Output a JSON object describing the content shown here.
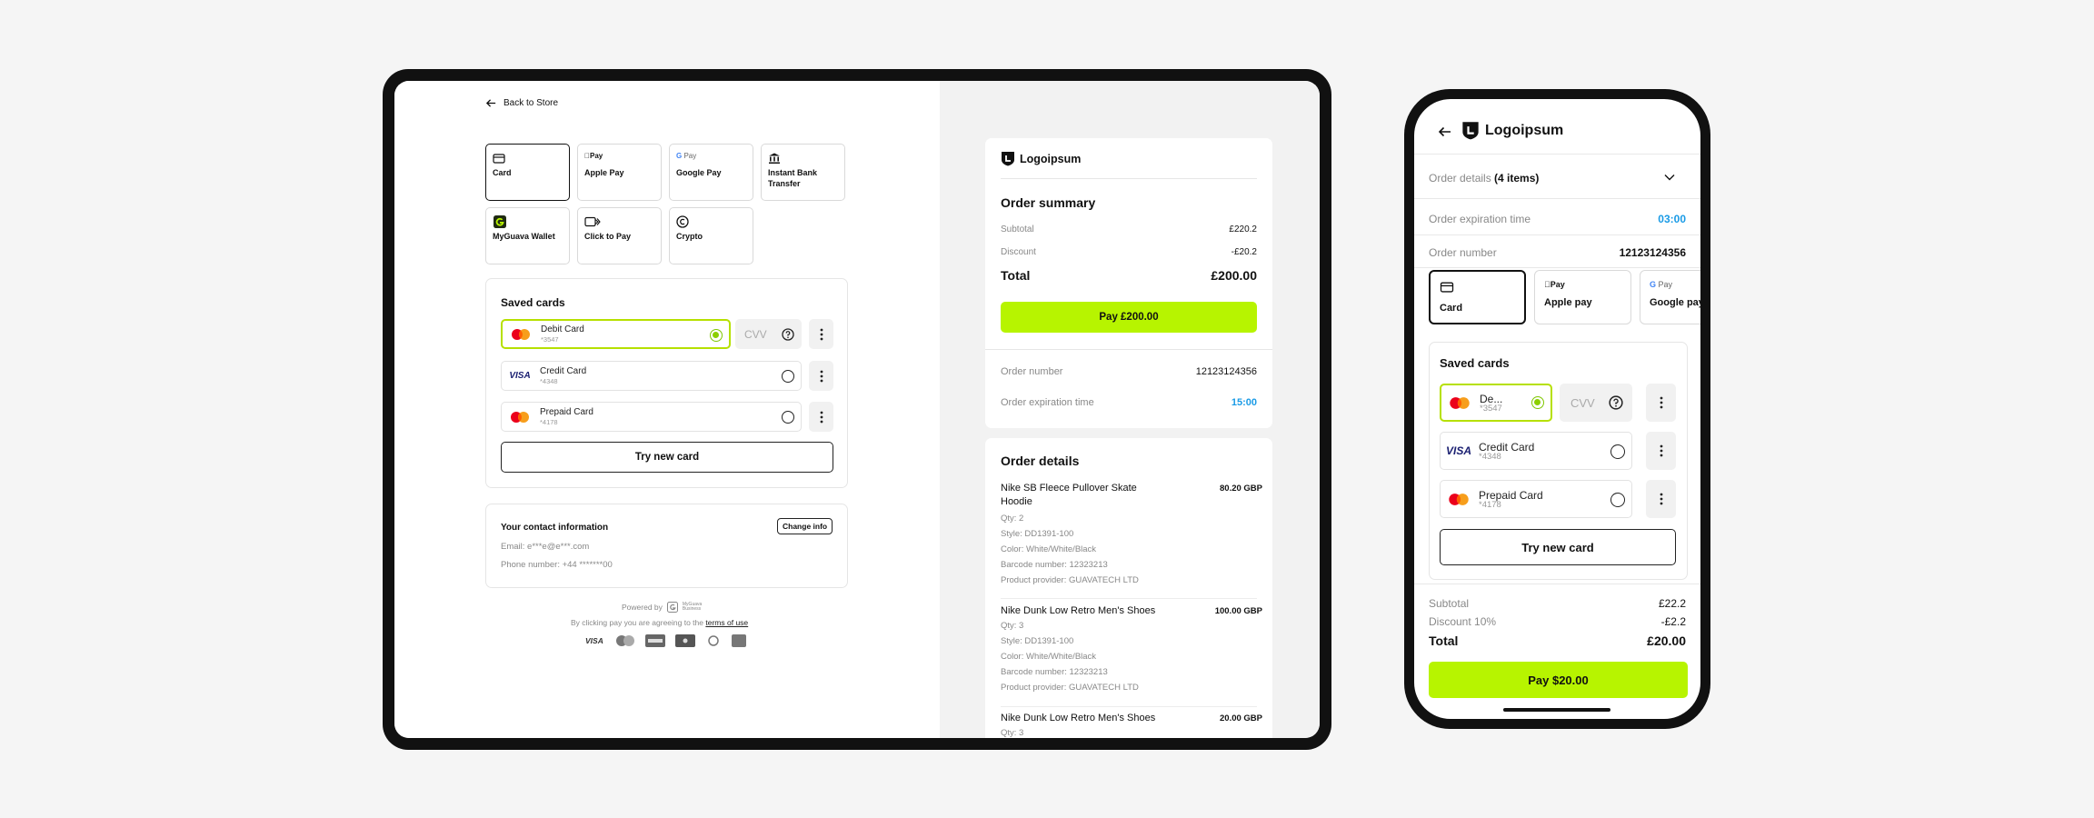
{
  "tablet": {
    "back_label": "Back to Store",
    "methods": [
      {
        "label": "Card",
        "icon": "card-icon"
      },
      {
        "label": "Apple Pay",
        "icon": "apple-pay-icon",
        "badge": "Pay"
      },
      {
        "label": "Google Pay",
        "icon": "google-pay-icon",
        "badge": "Pay"
      },
      {
        "label": "Instant Bank Transfer",
        "icon": "bank-icon"
      },
      {
        "label": "MyGuava Wallet",
        "icon": "myguava-icon"
      },
      {
        "label": "Click to Pay",
        "icon": "click-to-pay-icon"
      },
      {
        "label": "Crypto",
        "icon": "crypto-icon"
      }
    ],
    "saved_title": "Saved cards",
    "cards": [
      {
        "name": "Debit Card",
        "number": "*3547",
        "brand": "mastercard"
      },
      {
        "name": "Credit Card",
        "number": "*4348",
        "brand": "visa"
      },
      {
        "name": "Prepaid Card",
        "number": "*4178",
        "brand": "mastercard"
      }
    ],
    "cvv_placeholder": "CVV",
    "try_new": "Try new card",
    "contact_title": "Your contact information",
    "change_info": "Change info",
    "email": "Email: e***e@e***.com",
    "phone": "Phone number: +44 *******00",
    "powered_by": "Powered by",
    "powered_brand_1": "MyGuava",
    "powered_brand_2": "Business",
    "agree_prefix": "By clicking pay you are agreeing to the",
    "terms": "terms of use",
    "summary": {
      "brand": "Logoipsum",
      "title": "Order summary",
      "subtotal_label": "Subtotal",
      "subtotal": "£220.2",
      "discount_label": "Discount",
      "discount": "-£20.2",
      "total_label": "Total",
      "total": "£200.00",
      "pay_label": "Pay £200.00",
      "order_number_label": "Order number",
      "order_number": "12123124356",
      "expiration_label": "Order expiration time",
      "expiration": "15:00"
    },
    "details": {
      "title": "Order details",
      "items": [
        {
          "title": "Nike SB Fleece Pullover Skate Hoodie",
          "price": "80.20 GBP",
          "lines": [
            "Qty: 2",
            "Style: DD1391-100",
            "Color: White/White/Black",
            "Barcode number: 12323213",
            "Product provider: GUAVATECH LTD"
          ]
        },
        {
          "title": "Nike Dunk Low Retro Men's Shoes",
          "price": "100.00 GBP",
          "lines": [
            "Qty: 3",
            "Style: DD1391-100",
            "Color: White/White/Black",
            "Barcode number: 12323213",
            "Product provider: GUAVATECH LTD"
          ]
        },
        {
          "title": "Nike Dunk Low Retro Men's Shoes",
          "price": "20.00 GBP",
          "lines": [
            "Qty: 3"
          ]
        }
      ]
    }
  },
  "phone": {
    "brand": "Logoipsum",
    "order_details_label": "Order details",
    "order_details_count": "(4 items)",
    "expiration_label": "Order expiration time",
    "expiration": "03:00",
    "order_number_label": "Order number",
    "order_number": "12123124356",
    "methods": [
      {
        "label": "Card"
      },
      {
        "label": "Apple pay"
      },
      {
        "label": "Google pay"
      }
    ],
    "saved_title": "Saved cards",
    "cards": [
      {
        "name": "De...",
        "number": "*3547"
      },
      {
        "name": "Credit Card",
        "number": "*4348"
      },
      {
        "name": "Prepaid Card",
        "number": "*4178"
      }
    ],
    "cvv_placeholder": "CVV",
    "try_new": "Try new card",
    "subtotal_label": "Subtotal",
    "subtotal": "£22.2",
    "discount_label": "Discount 10%",
    "discount": "-£2.2",
    "total_label": "Total",
    "total": "£20.00",
    "pay_label": "Pay $20.00"
  },
  "colors": {
    "accent": "#b7f400",
    "selected_border": "#b6e000",
    "link_blue": "#1a9be6"
  }
}
